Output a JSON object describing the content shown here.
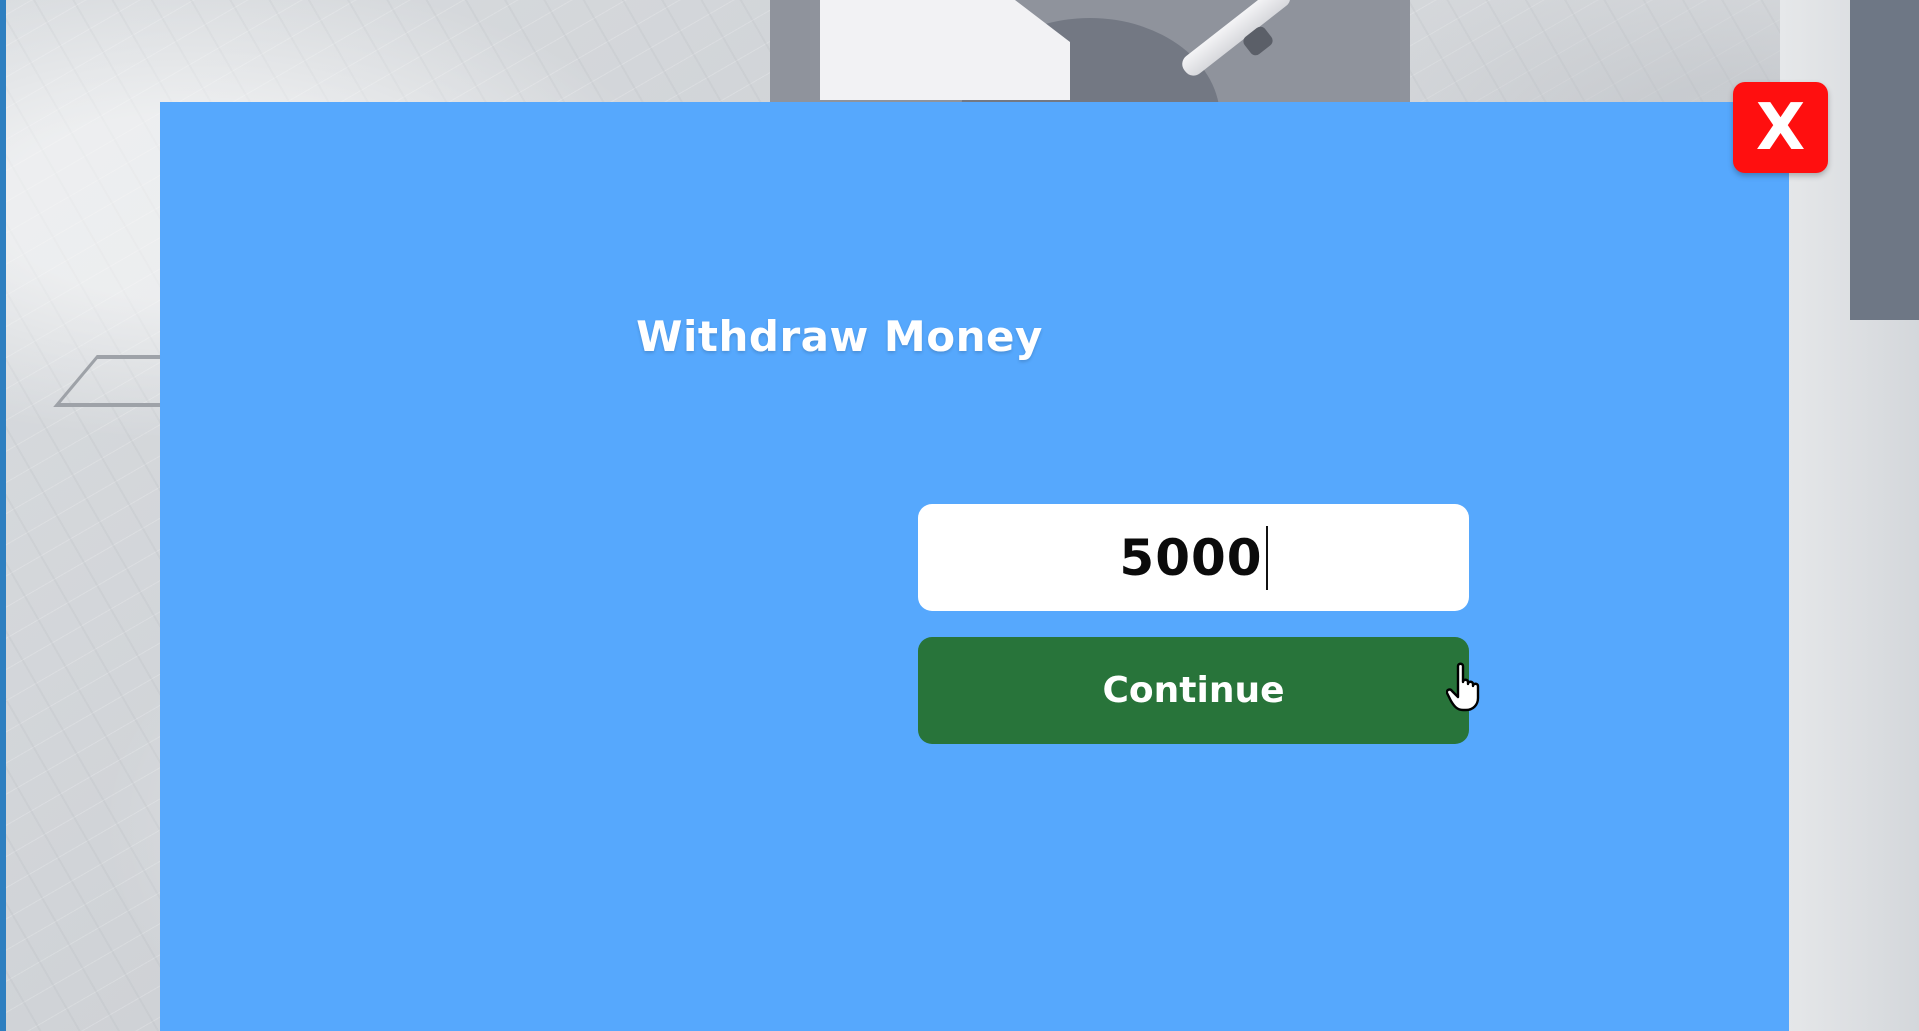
{
  "dialog": {
    "title": "Withdraw Money",
    "amount_value": "5000",
    "continue_label": "Continue",
    "close_label": "X"
  },
  "colors": {
    "panel_background": "#56a8fd",
    "continue_button": "#28743a",
    "close_button": "#ff0f0f",
    "input_background": "#ffffff"
  },
  "icons": {
    "cursor": "hand-pointer-icon"
  }
}
